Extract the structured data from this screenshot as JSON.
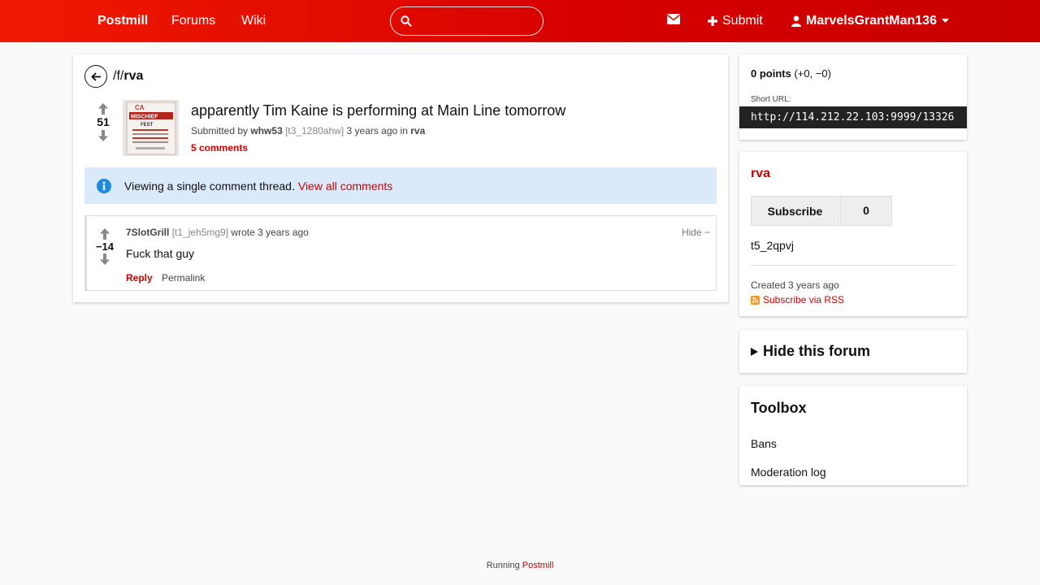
{
  "header": {
    "brand": "Postmill",
    "nav": [
      "Forums",
      "Wiki"
    ],
    "search_placeholder": "",
    "submit_label": "Submit",
    "username": "MarvelsGrantMan136"
  },
  "breadcrumb": {
    "prefix": "/f/",
    "forum": "rva"
  },
  "post": {
    "score": "51",
    "title": "apparently Tim Kaine is performing at Main Line tomorrow",
    "submitted_by": "Submitted by",
    "author": "whw53",
    "author_id": "[t3_1280ahw]",
    "age_in": "3 years ago in",
    "forum": "rva",
    "comments_label": "5 comments",
    "thumbnail_text": [
      "CA",
      "MISCHIEF",
      "FEST"
    ]
  },
  "alert": {
    "text": "Viewing a single comment thread.",
    "link": "View all comments"
  },
  "comment": {
    "score": "−14",
    "author": "7SlotGrill",
    "author_id": "[t1_jeh5mg9]",
    "wrote": "wrote 3 years ago",
    "hide": "Hide −",
    "body": "Fuck that guy",
    "reply": "Reply",
    "permalink": "Permalink"
  },
  "sidebar": {
    "points_bold": "0 points",
    "points_detail": "(+0, −0)",
    "short_url_label": "Short URL:",
    "short_url": "http://114.212.22.103:9999/13326",
    "forum_name": "rva",
    "subscribe_label": "Subscribe",
    "subscriber_count": "0",
    "forum_id": "t5_2qpvj",
    "created": "Created 3 years ago",
    "rss": "Subscribe via RSS",
    "hide_forum": "Hide this forum",
    "toolbox_title": "Toolbox",
    "toolbox_links": [
      "Bans",
      "Moderation log"
    ]
  },
  "footer": {
    "text": "Running",
    "link": "Postmill"
  },
  "colors": {
    "brand_red": "#e01000",
    "link_red": "#cc0000",
    "alert_bg": "#dbeafb",
    "info_blue": "#1e88e5",
    "rss_orange": "#f7931e"
  }
}
